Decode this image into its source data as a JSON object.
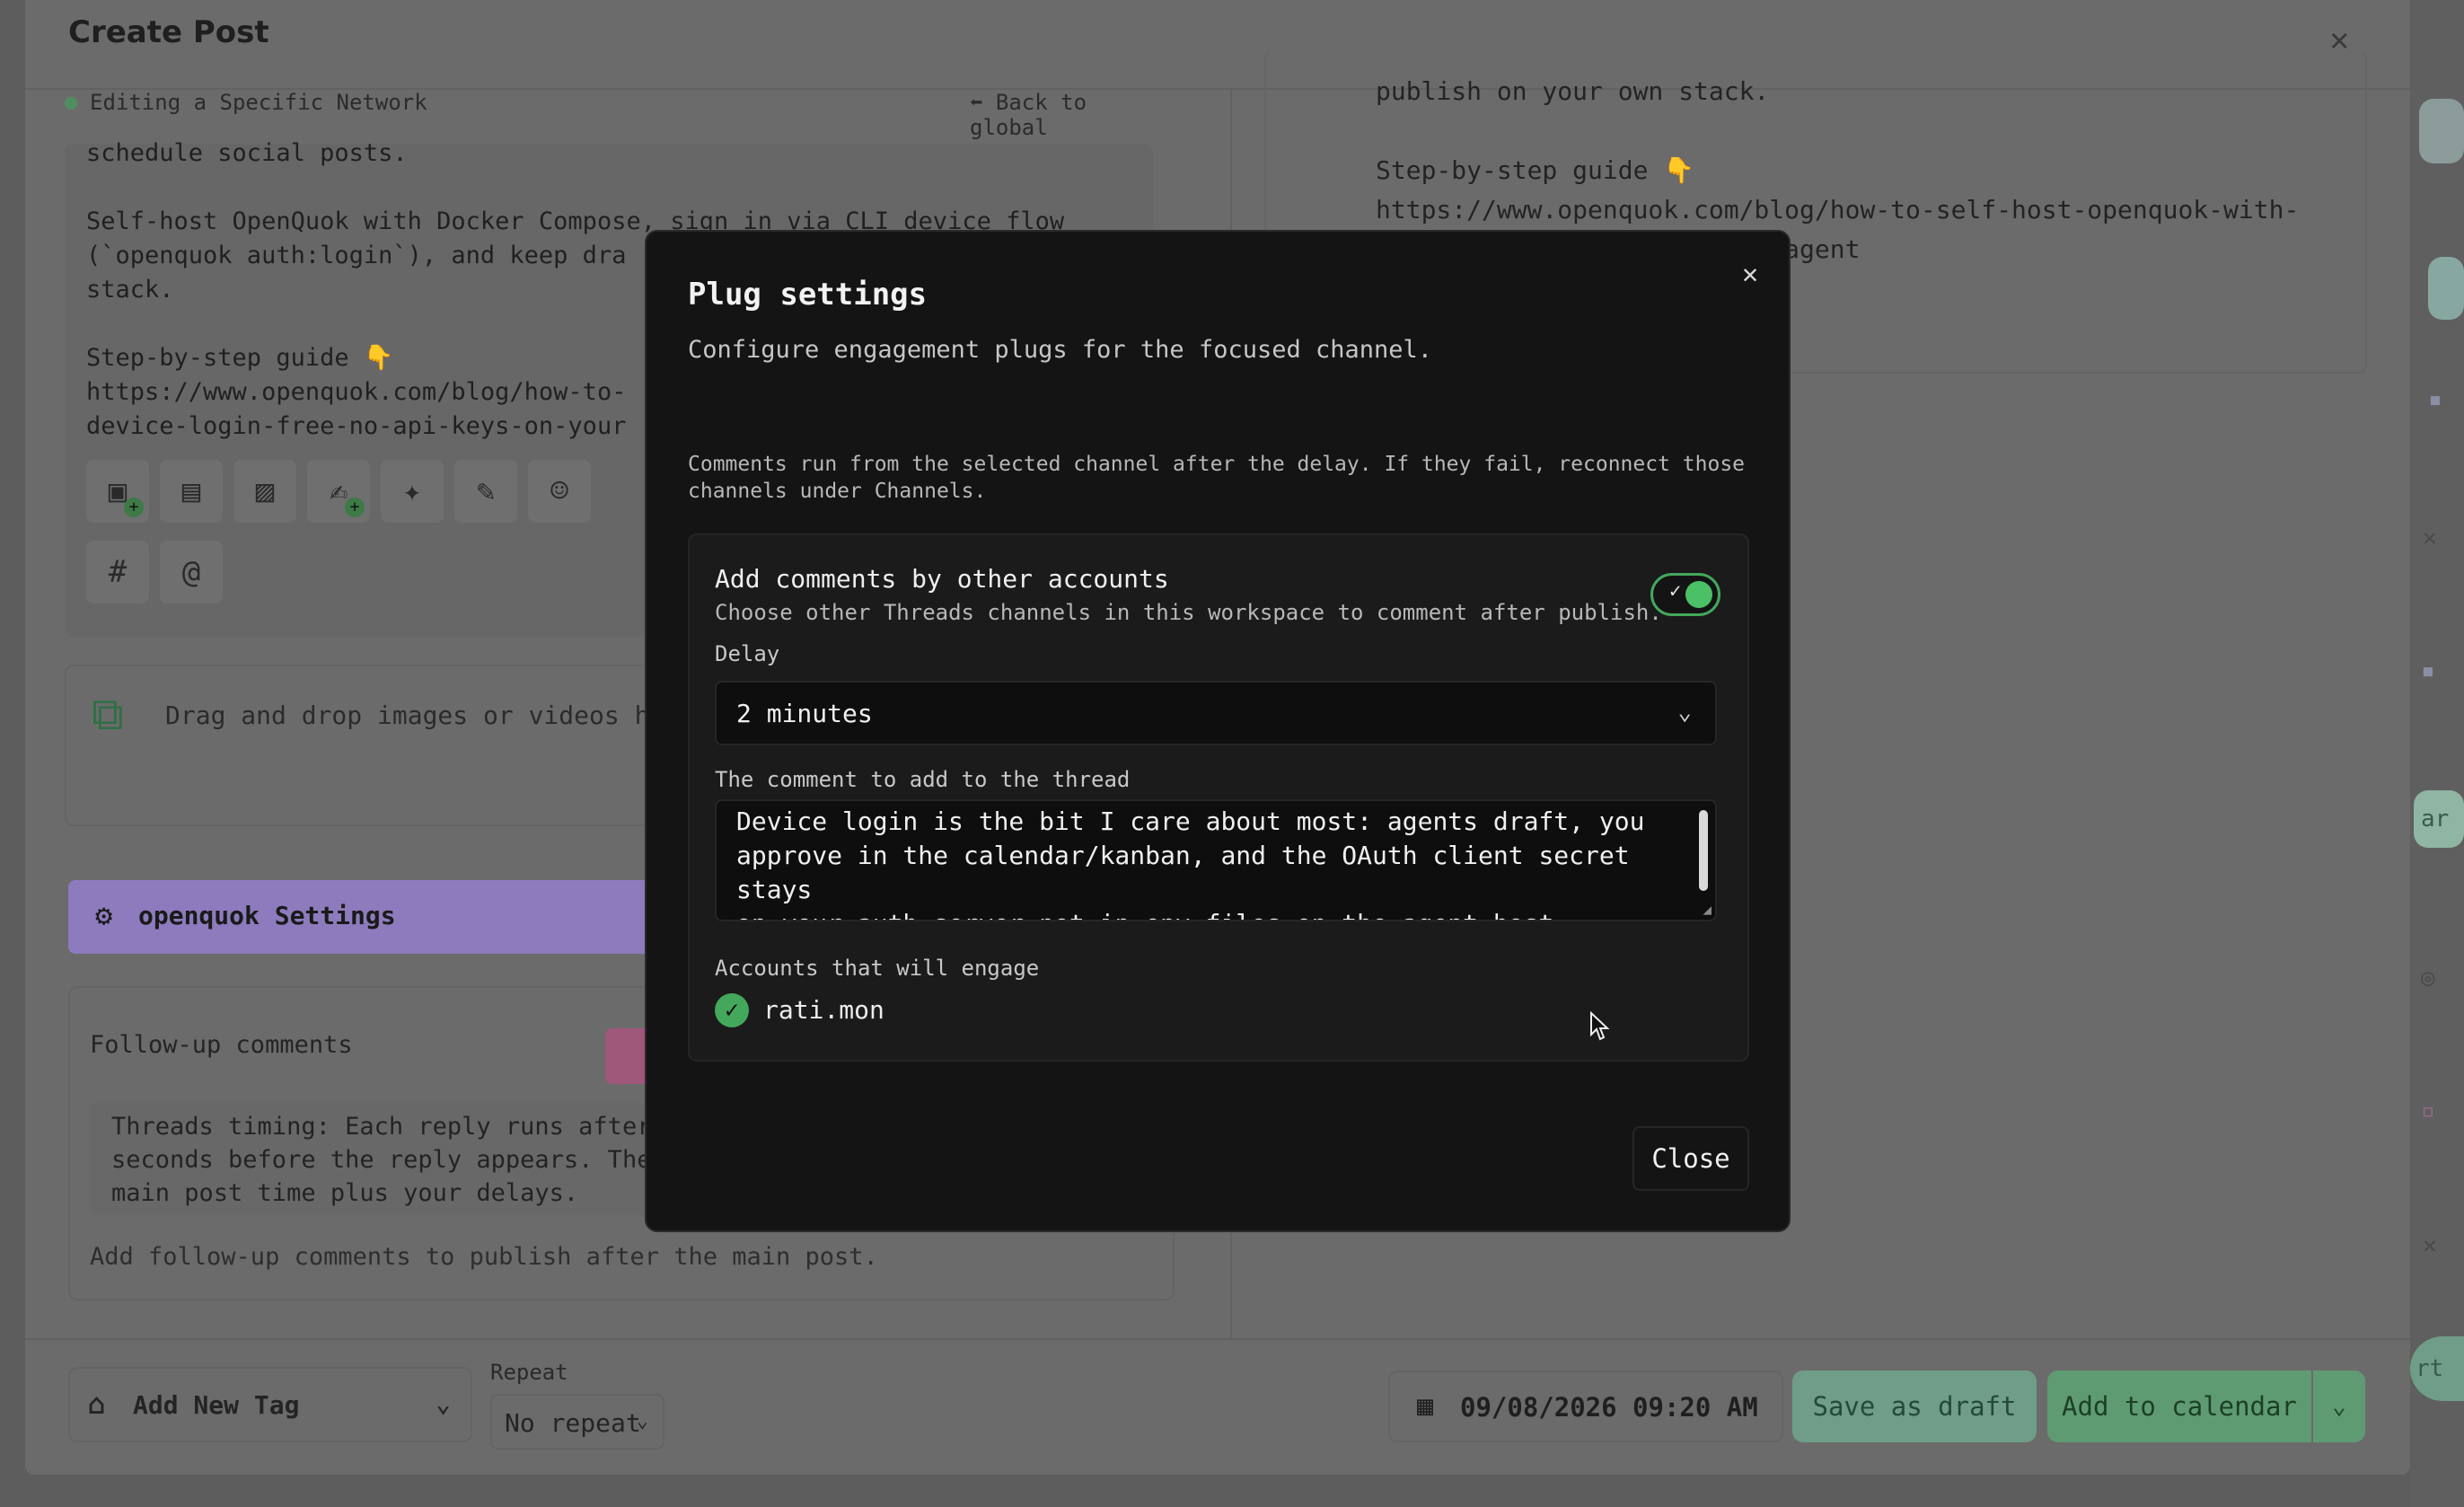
{
  "create_post": {
    "title": "Create Post",
    "editing_label": "Editing a Specific Network",
    "back_label": "Back to global",
    "editor_text": "schedule social posts.\n\nSelf-host OpenQuok with Docker Compose, sign in via CLI device flow\n(`openquok auth:login`), and keep dra\nstack.\n\nStep-by-step guide 👇\nhttps://www.openquok.com/blog/how-to-\ndevice-login-free-no-api-keys-on-your",
    "toolbar": {
      "icons": [
        "insert-media-icon",
        "gallery-icon",
        "image-icon",
        "signature-icon",
        "magic-wand-icon",
        "notes-icon",
        "user-icon"
      ],
      "row2": [
        {
          "icon": "hashtag-icon",
          "glyph": "#"
        },
        {
          "icon": "mention-icon",
          "glyph": "@"
        }
      ]
    },
    "dropzone_text": "Drag and drop images or videos her",
    "settings_label": "openquok Settings",
    "followup": {
      "title": "Follow-up comments",
      "timing_text": "Threads timing: Each reply runs after\nseconds before the reply appears. The\nmain post time plus your delays.",
      "hint": "Add follow-up comments to publish after the main post."
    },
    "preview_text": "publish on your own stack.\n\nStep-by-step guide 👇\nhttps://www.openquok.com/blog/how-to-self-host-openquok-with-\n            i-keys-on-your-agent",
    "footer": {
      "tag_label": "Add New Tag",
      "repeat_label": "Repeat",
      "repeat_value": "No repeat",
      "date_value": "09/08/2026 09:20 AM",
      "save_draft": "Save as draft",
      "add_calendar": "Add to calendar"
    }
  },
  "plug_settings": {
    "title": "Plug settings",
    "subtitle": "Configure engagement plugs for the focused channel.",
    "note": "Comments run from the selected channel after the delay. If they fail, reconnect those channels under Channels.",
    "toggle_title": "Add comments by other accounts",
    "toggle_desc": "Choose other Threads channels in this workspace to comment after publish.",
    "toggle_on": true,
    "delay_label": "Delay",
    "delay_value": "2 minutes",
    "comment_label": "The comment to add to the thread",
    "comment_value": "Device login is the bit I care about most: agents draft, you\napprove in the calendar/kanban, and the OAuth client secret stays\non your auth server—not in env files on the agent host.",
    "accounts_label": "Accounts that will engage",
    "accounts": [
      "rati.mon"
    ],
    "close_label": "Close"
  },
  "background_right": {
    "partial_button_1": "ar",
    "partial_button_2": "rt"
  },
  "colors": {
    "accent_green": "#43a85c",
    "settings_purple": "#8d7bbd",
    "dialog_bg": "#141414"
  }
}
